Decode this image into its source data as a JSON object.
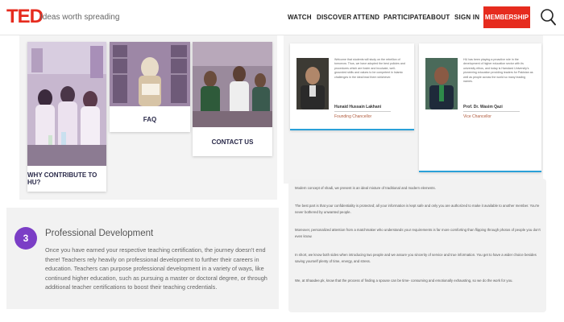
{
  "header": {
    "logo": "TED",
    "tagline": "Ideas worth spreading",
    "nav": [
      "WATCH",
      "DISCOVER",
      "ATTEND",
      "PARTICIPATE",
      "ABOUT",
      "SIGN IN"
    ],
    "membership": "MEMBERSHIP",
    "search_icon": "search-icon"
  },
  "tiles": {
    "why": "WHY CONTRIBUTE TO HU?",
    "faq": "FAQ",
    "contact": "CONTACT US"
  },
  "testimonials": [
    {
      "quote": "Welcome that students will study on the rebellion of tomorrow. Thus, we have adopted the best policies and procedures which are foster and inculcate, well-grounded skills and values to be competent in Islamic challenges in the ideal lead them whichever.",
      "name": "Hunaid Hussain Lakhani",
      "role": "Founding Chancellor"
    },
    {
      "quote": "HU has been playing a proactive role in the development of higher education sector with its university ethos, and today is Hamdard University's pioneering education providing leaders for Pakistan as well as people across the world so many leading names.",
      "name": "Prof. Dr. Wasim Qazi",
      "role": "Vice Chancellor"
    }
  ],
  "professional": {
    "number": "3",
    "title": "Professional Development",
    "body": "Once you have earned your respective teaching certification, the journey doesn't end there! Teachers rely heavily on professional development to further their careers in education. Teachers can purpose professional development in a variety of ways, like continued higher education, such as pursuing a master or doctoral degree, or through additional teacher certifications to boost their teaching credentials."
  },
  "article": {
    "p1": "Modern concept of shadi, we present is an ideal mixture of traditional and modern elements.",
    "p2": "The best part is that your confidentiality is protected; all your information is kept safe and only you are authorized to make it available to another member. You're never bothered by unwanted people.",
    "p3": "Moreover, personalized attention from a matchmaker who understands your requirements is far more comforting than flipping through photos of people you don't even know.",
    "p4": "In short, we know both sides when introducing two people and we assure you sincerity of service and true information. You get to have a wider choice besides saving yourself plenty of time, energy, and stress.",
    "p5": "We, at Shaadee.pk, know that the process of finding a spouse can be time- consuming and emotionally exhausting, so we do the work for you."
  },
  "colors": {
    "ted_red": "#e62b1e",
    "accent_purple": "#7b3ec6",
    "underline_blue": "#2aa0d8"
  }
}
